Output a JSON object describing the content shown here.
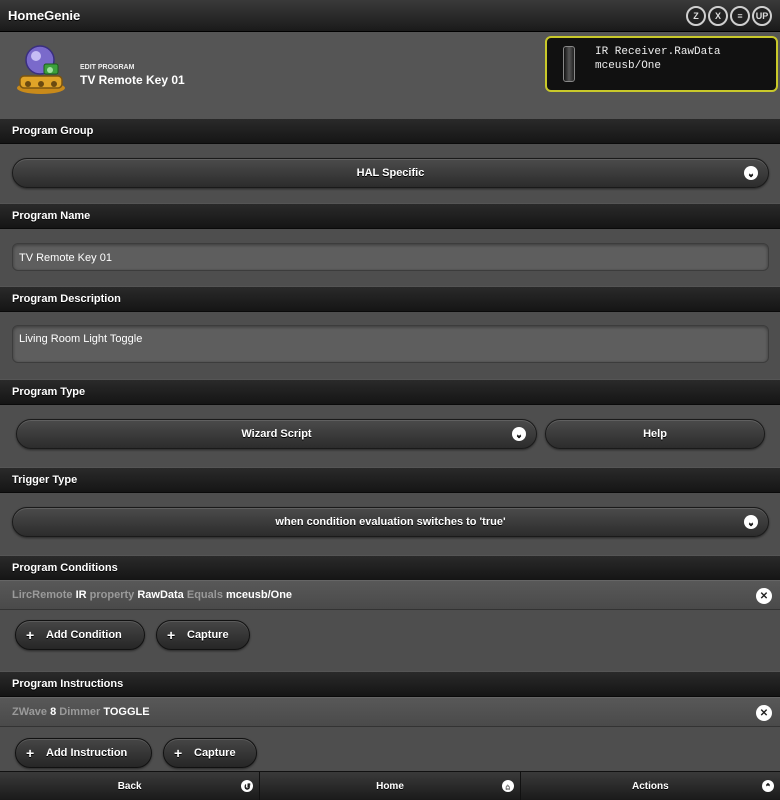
{
  "app": {
    "title": "HomeGenie"
  },
  "top_icons": [
    {
      "icon": "zwave-icon",
      "glyph": "Z"
    },
    {
      "icon": "x10-icon",
      "glyph": "X"
    },
    {
      "icon": "insteon-icon",
      "glyph": "≡"
    },
    {
      "icon": "upnp-icon",
      "glyph": "UP"
    }
  ],
  "header": {
    "subtitle": "EDIT PROGRAM",
    "title": "TV Remote Key 01",
    "icon": "program-robot-icon",
    "device": {
      "line1": "IR Receiver.RawData",
      "line2": "mceusb/One",
      "icon": "remote-control-icon"
    }
  },
  "sections": {
    "group": "Program Group",
    "name": "Program Name",
    "description": "Program Description",
    "type": "Program Type",
    "trigger": "Trigger Type",
    "conditions": "Program Conditions",
    "instructions": "Program Instructions"
  },
  "form": {
    "group_value": "HAL Specific",
    "name_value": "TV Remote Key 01",
    "description_value": "Living Room Light Toggle",
    "type_value": "Wizard Script",
    "help_label": "Help",
    "trigger_value": "when condition evaluation switches to 'true'"
  },
  "condition": {
    "domain": "LircRemote",
    "address": "IR",
    "property_word": "property",
    "property": "RawData",
    "comparator": "Equals",
    "value": "mceusb/One"
  },
  "condition_buttons": {
    "add": "Add Condition",
    "capture": "Capture"
  },
  "instruction": {
    "domain": "ZWave",
    "address": "8",
    "type": "Dimmer",
    "command": "TOGGLE"
  },
  "instruction_buttons": {
    "add": "Add Instruction",
    "capture": "Capture"
  },
  "bottom": {
    "back": "Back",
    "home": "Home",
    "actions": "Actions"
  },
  "colors": {
    "accent_border": "#c9c92a"
  }
}
